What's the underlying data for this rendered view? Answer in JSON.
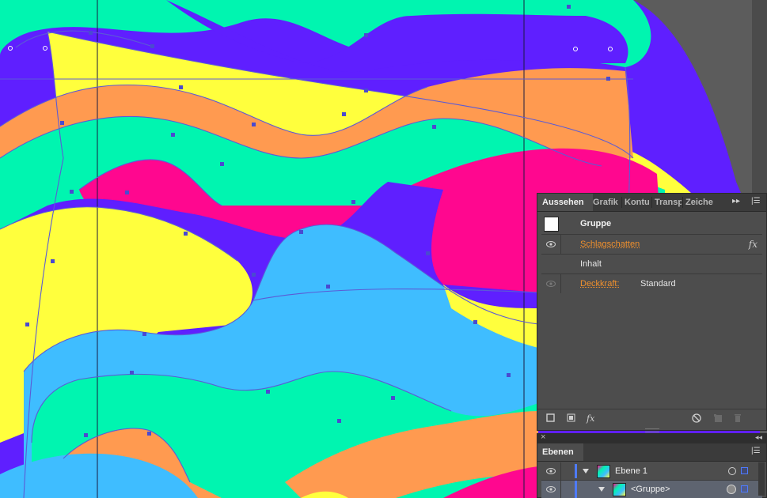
{
  "appearance_panel": {
    "tabs": [
      {
        "label": "Aussehen",
        "active": true
      },
      {
        "label": "Grafik",
        "active": false
      },
      {
        "label": "Kontu",
        "active": false
      },
      {
        "label": "Transp",
        "active": false
      },
      {
        "label": "Zeiche",
        "active": false
      }
    ],
    "menu_icon": "panel-menu-icon",
    "rows": {
      "object": {
        "label": "Gruppe"
      },
      "effect": {
        "label": "Schlagschatten",
        "fx": "fx"
      },
      "content": {
        "label": "Inhalt"
      },
      "opacity": {
        "label": "Deckkraft:",
        "value": "Standard"
      }
    },
    "bottom_icons": [
      "new-stroke-icon",
      "new-fill-icon",
      "fx-icon",
      "clear-icon",
      "duplicate-icon",
      "delete-icon"
    ],
    "bottom_fx": "fx"
  },
  "layers_panel": {
    "tab": "Ebenen",
    "rows": [
      {
        "name": "Ebene 1"
      },
      {
        "name": "<Gruppe>"
      }
    ]
  },
  "colors": {
    "purple": "#5f1fff",
    "mint": "#00f5b0",
    "yellow": "#ffff3d",
    "orange": "#ff9a50",
    "magenta": "#ff078f",
    "sky": "#3fbdff",
    "path": "#5b5bd6"
  }
}
